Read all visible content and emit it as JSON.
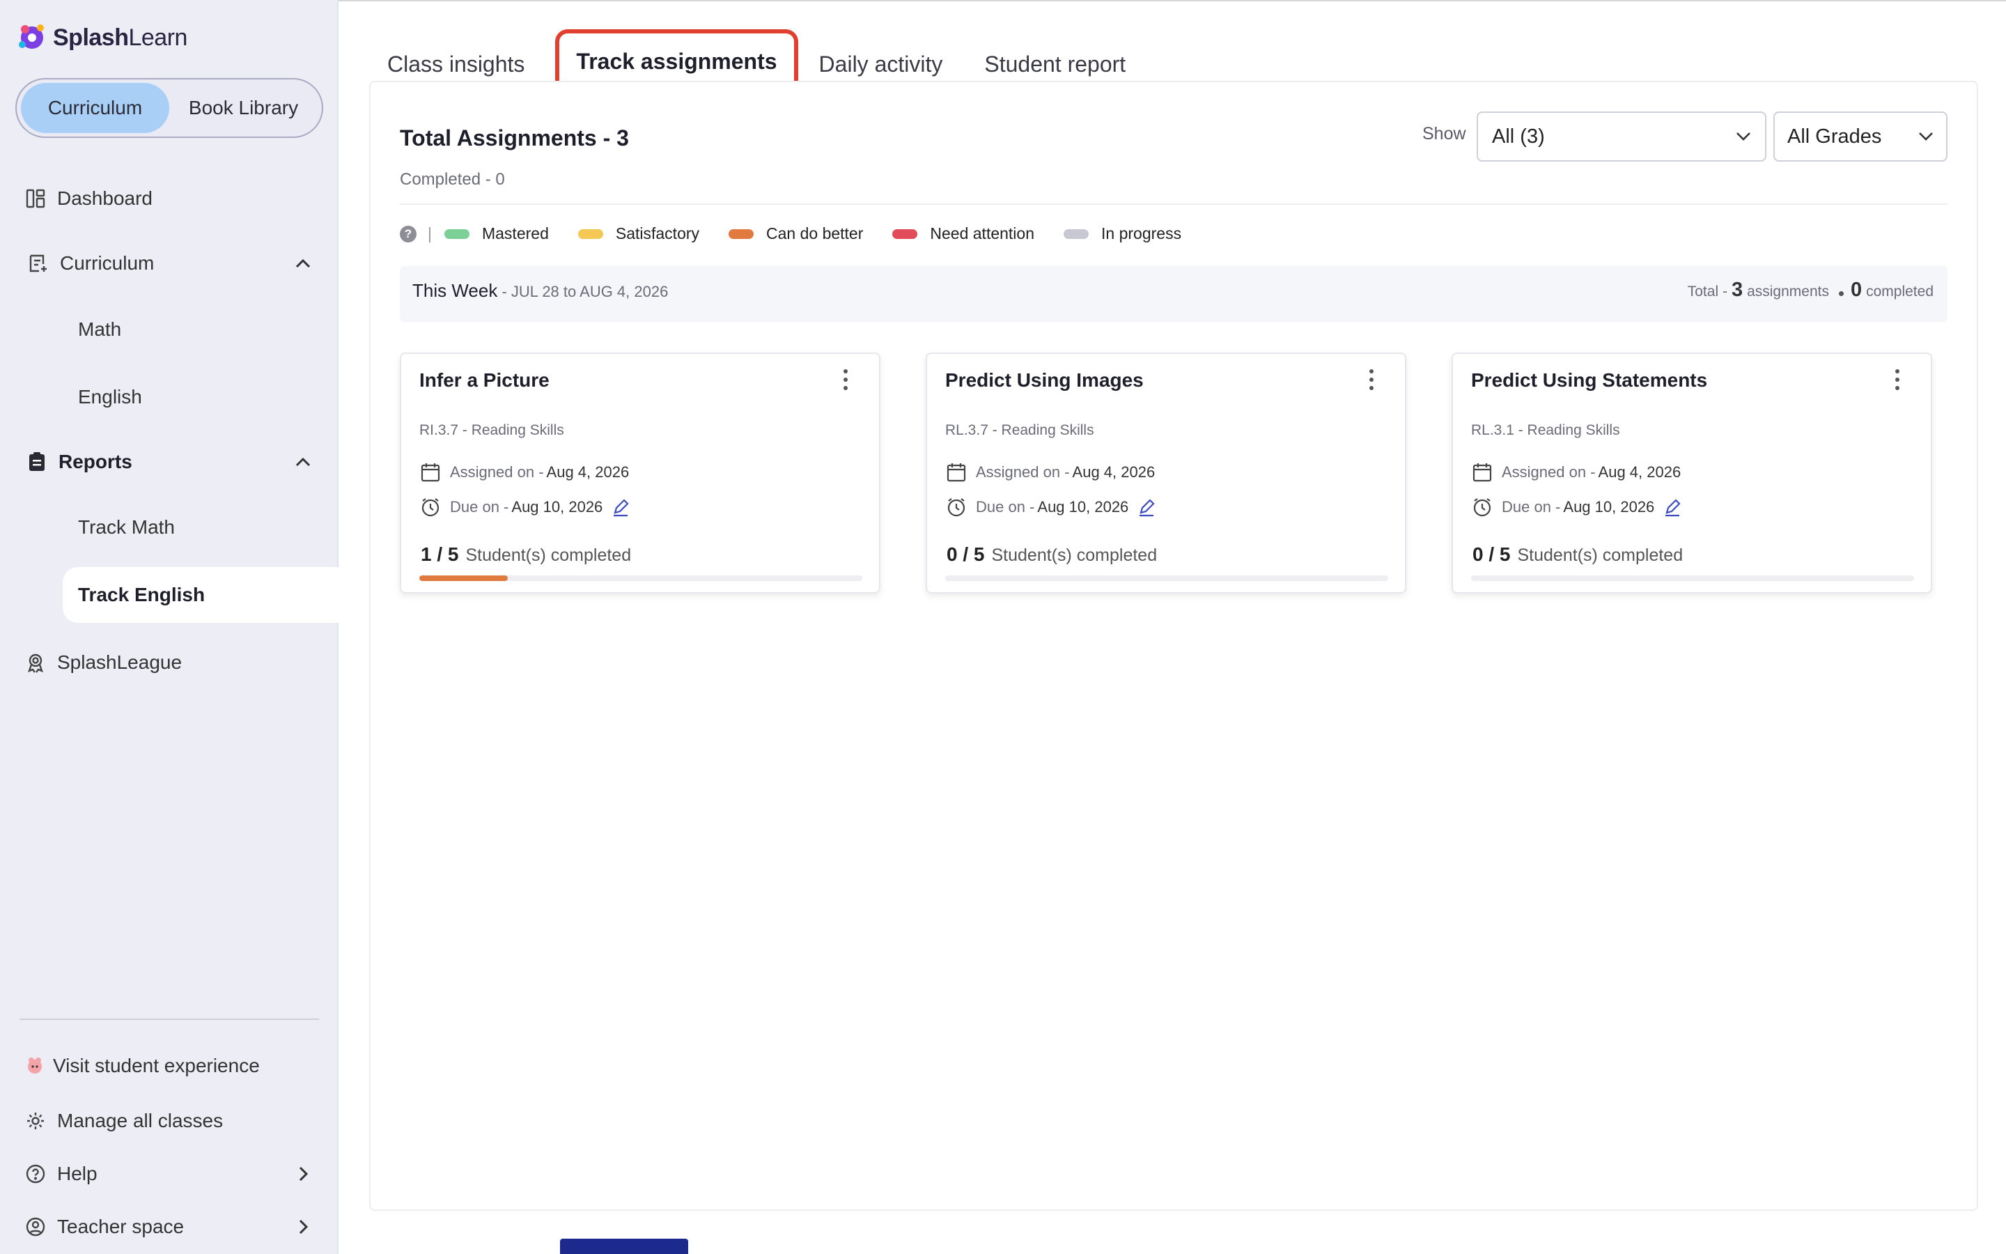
{
  "brand": {
    "name_bold": "Splash",
    "name_regular": "Learn"
  },
  "sidebar": {
    "segments": [
      {
        "label": "Curriculum",
        "active": true
      },
      {
        "label": "Book Library",
        "active": false
      }
    ],
    "nav": {
      "dashboard": "Dashboard",
      "curriculum": "Curriculum",
      "curriculum_children": [
        "Math",
        "English"
      ],
      "reports": "Reports",
      "reports_children": [
        "Track Math",
        "Track English"
      ],
      "splashleague": "SplashLeague"
    },
    "footer": {
      "visit": "Visit student experience",
      "manage": "Manage all classes",
      "help": "Help",
      "teacher": "Teacher space"
    }
  },
  "tabs": [
    "Class insights",
    "Track assignments",
    "Daily activity",
    "Student report"
  ],
  "active_tab": "Track assignments",
  "summary": {
    "title": "Total Assignments - 3",
    "completed": "Completed - 0",
    "show_label": "Show",
    "filter_selected": "All (3)",
    "grade_selected": "All Grades"
  },
  "legend": [
    {
      "label": "Mastered",
      "color": "#7ccf96"
    },
    {
      "label": "Satisfactory",
      "color": "#f5c754"
    },
    {
      "label": "Can do better",
      "color": "#e07a3f"
    },
    {
      "label": "Need attention",
      "color": "#e24c5a"
    },
    {
      "label": "In progress",
      "color": "#c8c8d4"
    }
  ],
  "week": {
    "title": "This Week",
    "range": " - JUL 28 to AUG 4, 2026",
    "total_prefix": "Total -",
    "total_count": "3",
    "total_suffix": "assignments",
    "completed_count": "0",
    "completed_suffix": "completed"
  },
  "cards": [
    {
      "title": "Infer a Picture",
      "standard": "RI.3.7 - Reading Skills",
      "assigned_label": "Assigned on -",
      "assigned": "Aug 4, 2026",
      "due_label": "Due on -",
      "due": "Aug 10, 2026",
      "count": "1 / 5",
      "count_label": "Student(s) completed",
      "progress": 0.2
    },
    {
      "title": "Predict Using Images",
      "standard": "RL.3.7 - Reading Skills",
      "assigned_label": "Assigned on -",
      "assigned": "Aug 4, 2026",
      "due_label": "Due on -",
      "due": "Aug 10, 2026",
      "count": "0 / 5",
      "count_label": "Student(s) completed",
      "progress": 0
    },
    {
      "title": "Predict Using Statements",
      "standard": "RL.3.1 - Reading Skills",
      "assigned_label": "Assigned on -",
      "assigned": "Aug 4, 2026",
      "due_label": "Due on -",
      "due": "Aug 10, 2026",
      "count": "0 / 5",
      "count_label": "Student(s) completed",
      "progress": 0
    }
  ]
}
